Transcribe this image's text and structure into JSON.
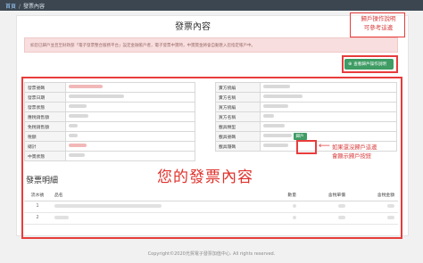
{
  "breadcrumb": {
    "home": "首頁",
    "separator": "/",
    "current": "發票內容"
  },
  "page_title": "發票內容",
  "alert_text": "如您已歸戶並且至財政部「電子發票整合服務平台」設定金融帳戶者，電子發票中獎時，中獎獎金將會自動匯入您指定帳戶中。",
  "guide_button": {
    "icon": "plus-circle-icon",
    "label": "查看歸戶操作說明"
  },
  "annotations": {
    "guide_lines": [
      "歸戶操作說明",
      "可參考這邊"
    ],
    "open_lines": [
      "如果還沒歸戶這邊",
      "會顯示歸戶按鈕"
    ],
    "arrow": "⟵",
    "big": "您的發票內容"
  },
  "left_table": {
    "labels": [
      "發票號碼",
      "發票日期",
      "發票狀態",
      "應稅銷售額",
      "免稅銷售額",
      "稅額",
      "總計",
      "中獎狀態"
    ]
  },
  "right_table": {
    "labels": [
      "賣方統編",
      "賣方名稱",
      "買方統編",
      "買方名稱",
      "載具類型",
      "載具號碼",
      "載具隱碼"
    ],
    "open_button": "歸戶"
  },
  "items_section": {
    "title": "發票明細",
    "columns": [
      "流水號",
      "品名",
      "數量",
      "含稅單價",
      "含稅金額"
    ],
    "rows": [
      {
        "no": "1"
      },
      {
        "no": "2"
      }
    ]
  },
  "footer": "Copyright©2020光貿電子發票加值中心. All rights reserved.",
  "colors": {
    "accent_green": "#3e9c64",
    "annotation_red": "#e83c3c",
    "topbar": "#3b4651"
  }
}
